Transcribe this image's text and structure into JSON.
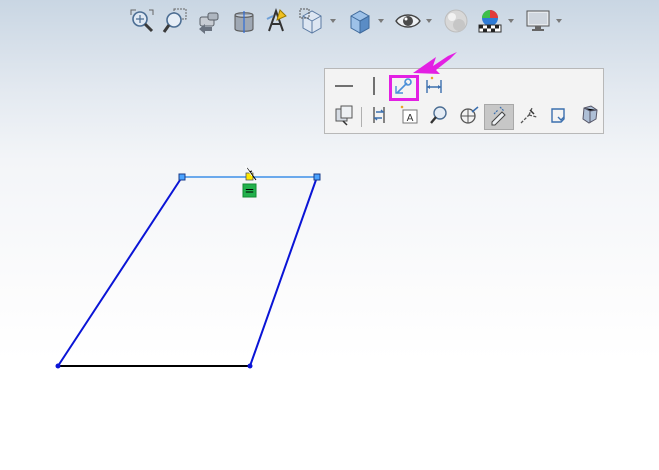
{
  "heads_up_toolbar": {
    "items": [
      {
        "icon": "zoom-to-fit-icon",
        "dropdown": false
      },
      {
        "icon": "zoom-to-area-icon",
        "dropdown": false
      },
      {
        "icon": "previous-view-icon",
        "dropdown": false
      },
      {
        "icon": "section-view-icon",
        "dropdown": false
      },
      {
        "icon": "dynamic-annotation-views-icon",
        "dropdown": false
      },
      {
        "icon": "view-orientation-icon",
        "dropdown": true
      },
      {
        "icon": "display-style-icon",
        "dropdown": true
      },
      {
        "icon": "hide-show-items-icon",
        "dropdown": true
      },
      {
        "icon": "edit-appearance-icon",
        "dropdown": false
      },
      {
        "icon": "apply-scene-icon",
        "dropdown": true
      },
      {
        "icon": "view-settings-icon",
        "dropdown": true
      }
    ]
  },
  "context_toolbar": {
    "row1": [
      {
        "icon": "make-horizontal-icon",
        "pressed": false,
        "highlighted": false
      },
      {
        "icon": "make-vertical-icon",
        "pressed": false,
        "highlighted": false
      },
      {
        "icon": "fix-relation-icon",
        "pressed": false,
        "highlighted": true
      },
      {
        "icon": "smart-dimension-icon",
        "pressed": false,
        "highlighted": false
      }
    ],
    "row2": [
      {
        "icon": "show-relations-icon",
        "pressed": false
      },
      {
        "icon": "convert-entities-icon",
        "pressed": false
      },
      {
        "icon": "sketch-text-icon",
        "pressed": false
      },
      {
        "icon": "zoom-to-selection-icon",
        "pressed": false
      },
      {
        "icon": "normal-to-icon",
        "pressed": false
      },
      {
        "icon": "sketch-edit-icon",
        "pressed": true
      },
      {
        "icon": "construction-geometry-icon",
        "pressed": false
      },
      {
        "icon": "rapid-sketch-icon",
        "pressed": false
      },
      {
        "icon": "select-other-icon",
        "pressed": false
      }
    ]
  },
  "annotation": {
    "arrow_color": "#e320e3",
    "target": "fix-relation-icon"
  },
  "sketch": {
    "selected_segment": "top-line",
    "relation_badge": "=",
    "colors": {
      "selected": "#3d8fe8",
      "underdefined": "#0a14d6",
      "defined": "#000000",
      "badge": "#22b14c"
    }
  }
}
